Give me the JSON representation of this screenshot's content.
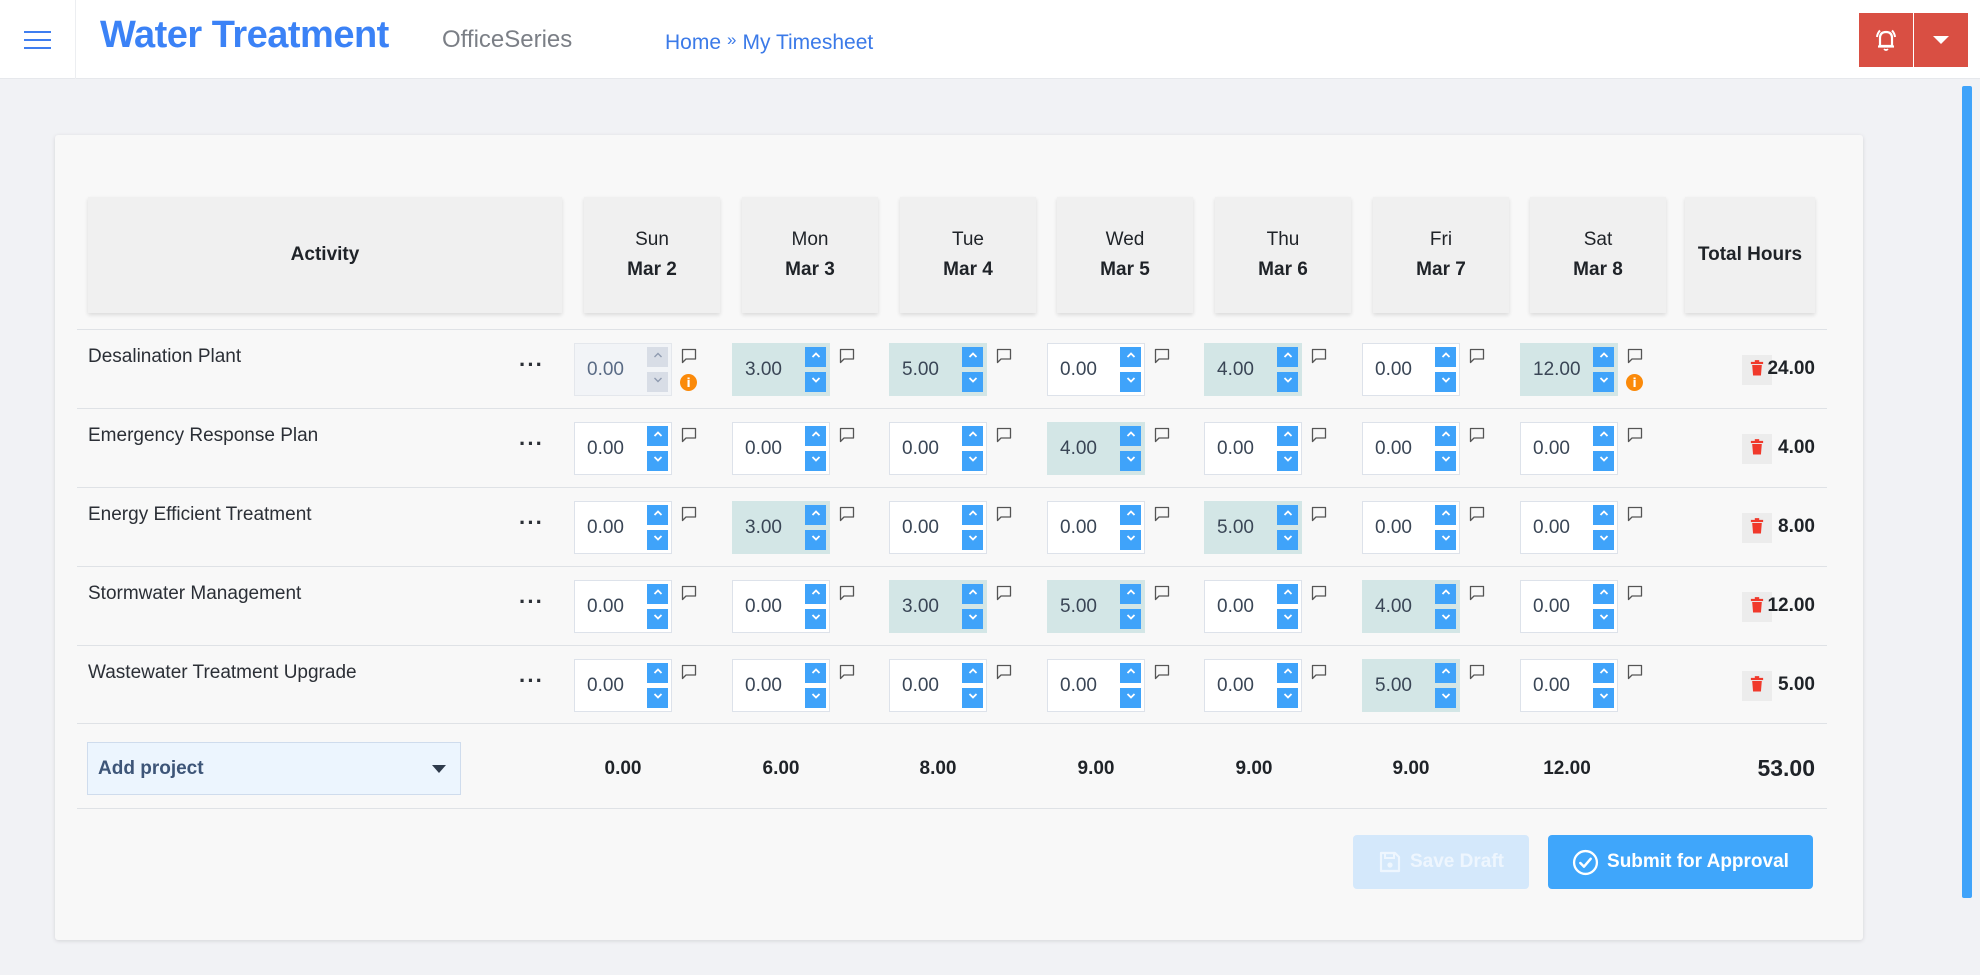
{
  "header": {
    "app_title": "Water Treatment",
    "app_subtitle": "OfficeSeries",
    "breadcrumb": [
      {
        "label": "Home"
      },
      {
        "label": "My Timesheet"
      }
    ],
    "breadcrumb_separator": "»",
    "icons": {
      "menu": "hamburger-menu-icon",
      "notifications": "bell-alert-icon",
      "dropdown": "caret-down-icon"
    },
    "accent_color": "#3b82f6",
    "header_button_color": "#d94f43"
  },
  "timesheet": {
    "activity_header": "Activity",
    "total_header": "Total Hours",
    "days": [
      {
        "dow": "Sun",
        "date": "Mar 2"
      },
      {
        "dow": "Mon",
        "date": "Mar 3"
      },
      {
        "dow": "Tue",
        "date": "Mar 4"
      },
      {
        "dow": "Wed",
        "date": "Mar 5"
      },
      {
        "dow": "Thu",
        "date": "Mar 6"
      },
      {
        "dow": "Fri",
        "date": "Mar 7"
      },
      {
        "dow": "Sat",
        "date": "Mar 8"
      }
    ],
    "rows": [
      {
        "name": "Desalination Plant",
        "menu_label": "···",
        "hours": [
          "0.00",
          "3.00",
          "5.00",
          "0.00",
          "4.00",
          "0.00",
          "12.00"
        ],
        "highlighted": [
          false,
          true,
          true,
          false,
          true,
          false,
          true
        ],
        "disabled": [
          true,
          false,
          false,
          false,
          false,
          false,
          false
        ],
        "info": [
          true,
          false,
          false,
          false,
          false,
          false,
          true
        ],
        "total": "24.00"
      },
      {
        "name": "Emergency Response Plan",
        "menu_label": "···",
        "hours": [
          "0.00",
          "0.00",
          "0.00",
          "4.00",
          "0.00",
          "0.00",
          "0.00"
        ],
        "highlighted": [
          false,
          false,
          false,
          true,
          false,
          false,
          false
        ],
        "disabled": [
          false,
          false,
          false,
          false,
          false,
          false,
          false
        ],
        "info": [
          false,
          false,
          false,
          false,
          false,
          false,
          false
        ],
        "total": "4.00"
      },
      {
        "name": "Energy Efficient Treatment",
        "menu_label": "···",
        "hours": [
          "0.00",
          "3.00",
          "0.00",
          "0.00",
          "5.00",
          "0.00",
          "0.00"
        ],
        "highlighted": [
          false,
          true,
          false,
          false,
          true,
          false,
          false
        ],
        "disabled": [
          false,
          false,
          false,
          false,
          false,
          false,
          false
        ],
        "info": [
          false,
          false,
          false,
          false,
          false,
          false,
          false
        ],
        "total": "8.00"
      },
      {
        "name": "Stormwater Management",
        "menu_label": "···",
        "hours": [
          "0.00",
          "0.00",
          "3.00",
          "5.00",
          "0.00",
          "4.00",
          "0.00"
        ],
        "highlighted": [
          false,
          false,
          true,
          true,
          false,
          true,
          false
        ],
        "disabled": [
          false,
          false,
          false,
          false,
          false,
          false,
          false
        ],
        "info": [
          false,
          false,
          false,
          false,
          false,
          false,
          false
        ],
        "total": "12.00"
      },
      {
        "name": "Wastewater Treatment Upgrade",
        "menu_label": "···",
        "hours": [
          "0.00",
          "0.00",
          "0.00",
          "0.00",
          "0.00",
          "5.00",
          "0.00"
        ],
        "highlighted": [
          false,
          false,
          false,
          false,
          false,
          true,
          false
        ],
        "disabled": [
          false,
          false,
          false,
          false,
          false,
          false,
          false
        ],
        "info": [
          false,
          false,
          false,
          false,
          false,
          false,
          false
        ],
        "total": "5.00"
      }
    ],
    "day_totals": [
      "0.00",
      "6.00",
      "8.00",
      "9.00",
      "9.00",
      "9.00",
      "12.00"
    ],
    "grand_total": "53.00",
    "add_project": {
      "label": "Add project"
    },
    "highlight_color": "#d3e6e6",
    "spinner_color": "#3fa3fa",
    "delete_icon_color": "#f0392b",
    "info_icon_color": "#fb8a0a"
  },
  "actions": {
    "save_draft": {
      "label": "Save Draft",
      "enabled": false,
      "icon": "floppy-disk-icon"
    },
    "submit": {
      "label": "Submit for Approval",
      "enabled": true,
      "icon": "check-circle-icon"
    }
  }
}
